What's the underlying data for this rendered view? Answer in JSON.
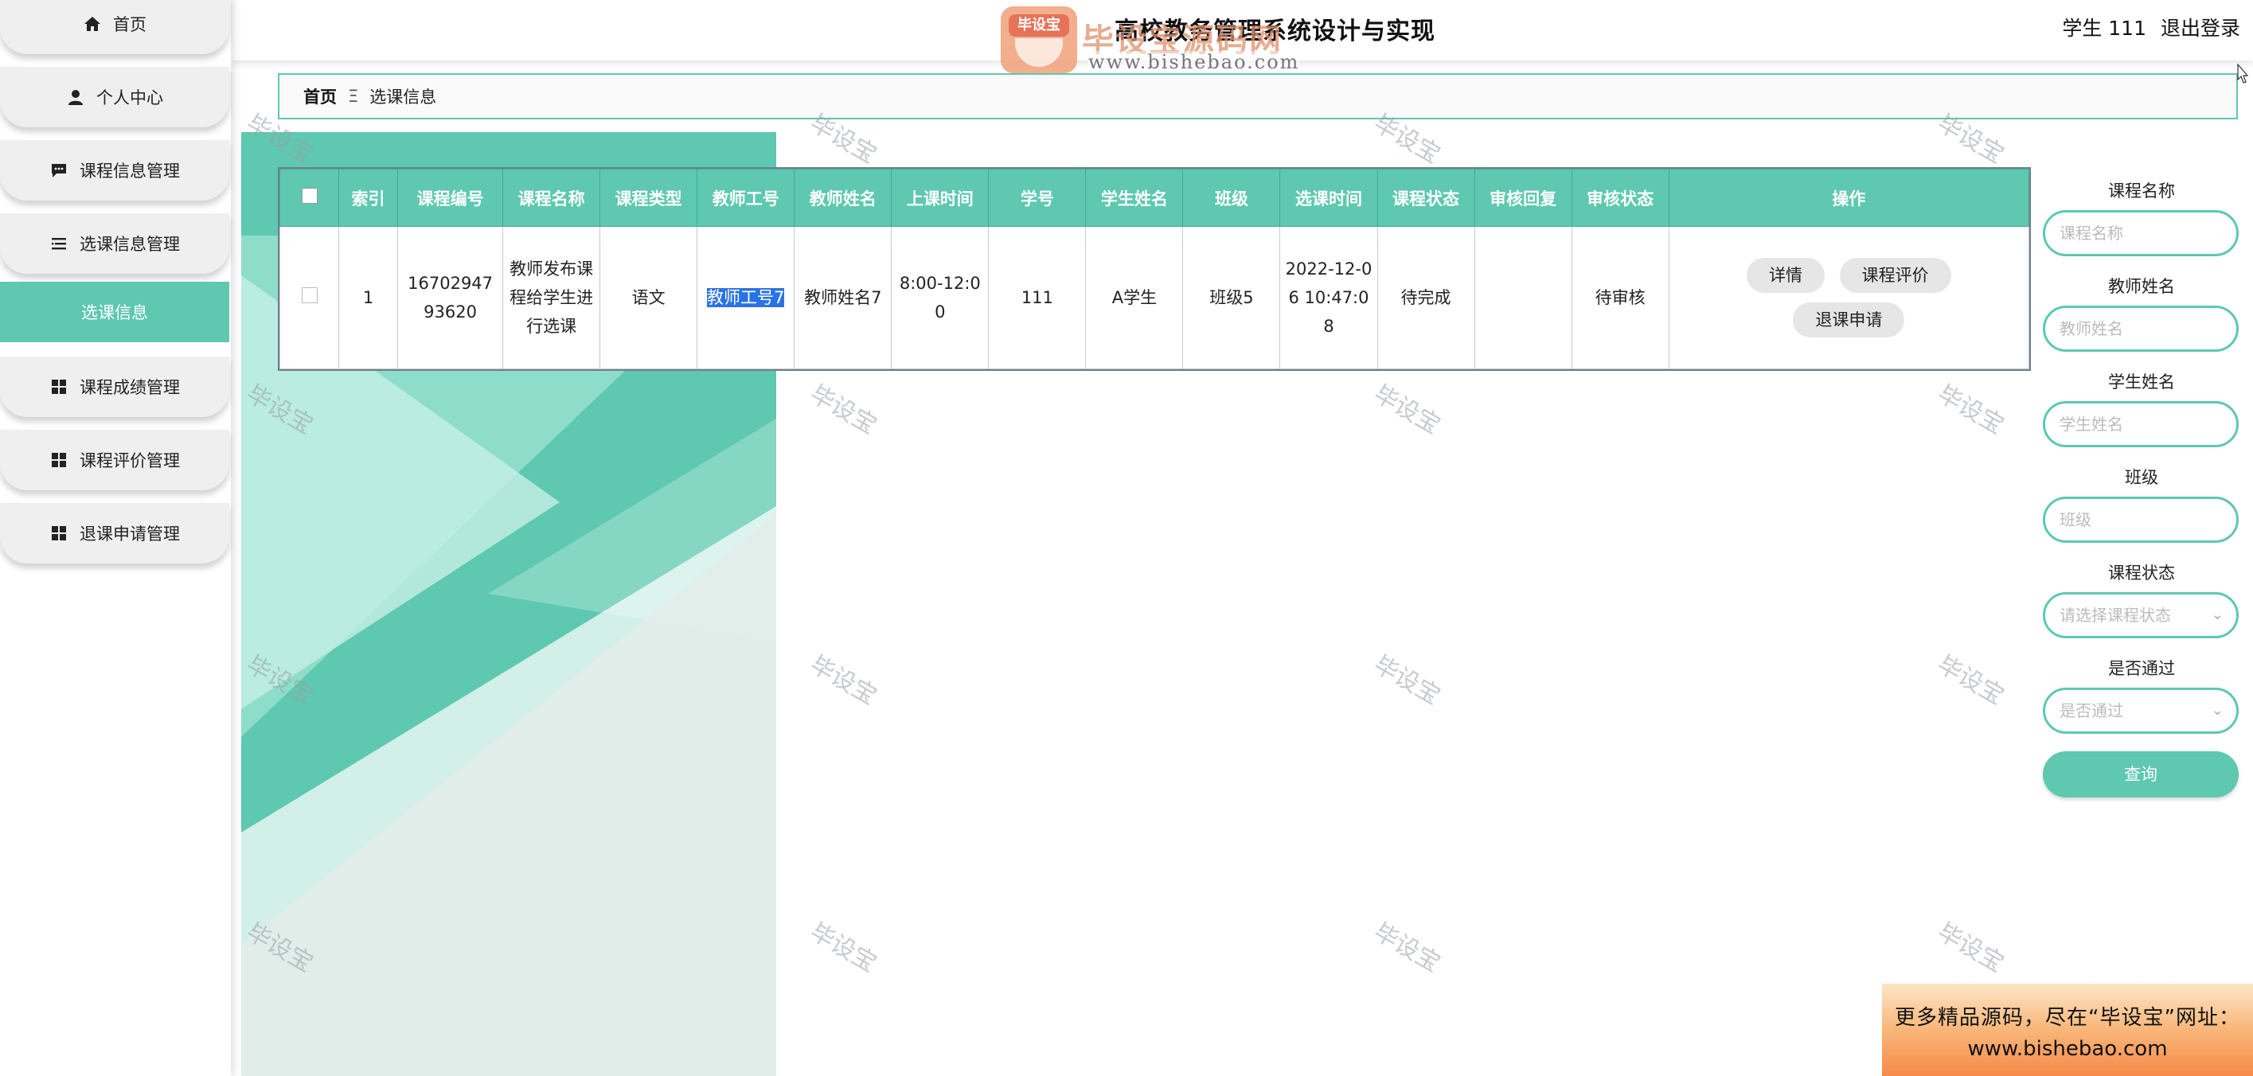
{
  "header": {
    "title": "高校教务管理系统设计与实现",
    "user": "学生 111",
    "logout": "退出登录"
  },
  "watermark": {
    "badge": "毕设宝",
    "name": "毕设宝源码网",
    "url": "www.bishebao.com",
    "tile": "毕设宝"
  },
  "sidebar": {
    "items": [
      {
        "label": "首页",
        "icon": "home-icon"
      },
      {
        "label": "个人中心",
        "icon": "user-icon"
      },
      {
        "label": "课程信息管理",
        "icon": "chat-icon"
      },
      {
        "label": "选课信息管理",
        "icon": "list-icon"
      },
      {
        "label": "选课信息",
        "icon": ""
      },
      {
        "label": "课程成绩管理",
        "icon": "grid-icon"
      },
      {
        "label": "课程评价管理",
        "icon": "grid-icon"
      },
      {
        "label": "退课申请管理",
        "icon": "grid-icon"
      }
    ]
  },
  "breadcrumb": {
    "home": "首页",
    "separator": "Ξ",
    "current": "选课信息"
  },
  "table": {
    "headers": [
      "索引",
      "课程编号",
      "课程名称",
      "课程类型",
      "教师工号",
      "教师姓名",
      "上课时间",
      "学号",
      "学生姓名",
      "班级",
      "选课时间",
      "课程状态",
      "审核回复",
      "审核状态",
      "操作"
    ],
    "rows": [
      {
        "index": "1",
        "course_no": "1670294793620",
        "course_name": "教师发布课程给学生进行选课",
        "course_type": "语文",
        "teacher_no": "教师工号7",
        "teacher_name": "教师姓名7",
        "class_time": "8:00-12:00",
        "student_no": "111",
        "student_name": "A学生",
        "class": "班级5",
        "select_time": "2022-12-06 10:47:08",
        "course_status": "待完成",
        "review_reply": "",
        "review_status": "待审核",
        "actions": [
          "详情",
          "课程评价",
          "退课申请"
        ]
      }
    ]
  },
  "search": {
    "course_name_label": "课程名称",
    "course_name_placeholder": "课程名称",
    "teacher_name_label": "教师姓名",
    "teacher_name_placeholder": "教师姓名",
    "student_name_label": "学生姓名",
    "student_name_placeholder": "学生姓名",
    "class_label": "班级",
    "class_placeholder": "班级",
    "course_status_label": "课程状态",
    "course_status_value": "请选择课程状态",
    "passed_label": "是否通过",
    "passed_value": "是否通过",
    "query_button": "查询"
  },
  "promo": {
    "line1": "更多精品源码，尽在“毕设宝”网址：",
    "line2": "www.bishebao.com"
  },
  "colors": {
    "accent": "#5ec8b0",
    "selection": "#2a73e3"
  }
}
